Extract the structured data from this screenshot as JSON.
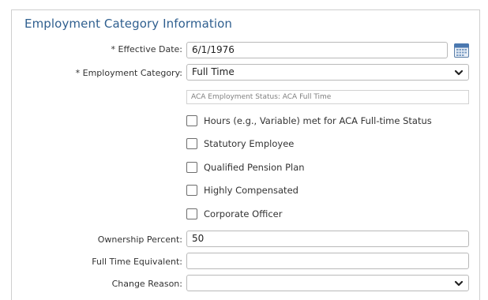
{
  "section": {
    "title": "Employment Category Information"
  },
  "effective_date": {
    "label": "* Effective Date:",
    "value": "6/1/1976"
  },
  "employment_category": {
    "label": "* Employment Category:",
    "value": "Full Time"
  },
  "aca_status": {
    "text": "ACA Employment Status: ACA Full Time"
  },
  "checkboxes": [
    {
      "label": "Hours (e.g., Variable) met for ACA Full-time Status",
      "checked": false
    },
    {
      "label": "Statutory Employee",
      "checked": false
    },
    {
      "label": "Qualified Pension Plan",
      "checked": false
    },
    {
      "label": "Highly Compensated",
      "checked": false
    },
    {
      "label": "Corporate Officer",
      "checked": false
    }
  ],
  "ownership_percent": {
    "label": "Ownership Percent:",
    "value": "50"
  },
  "full_time_equivalent": {
    "label": "Full Time Equivalent:",
    "value": ""
  },
  "change_reason": {
    "label": "Change Reason:",
    "value": ""
  },
  "icons": {
    "calendar": "calendar-icon",
    "dropdown": "chevron-down-icon"
  },
  "colors": {
    "title": "#2f5f8f",
    "border": "#b9b9b9"
  }
}
